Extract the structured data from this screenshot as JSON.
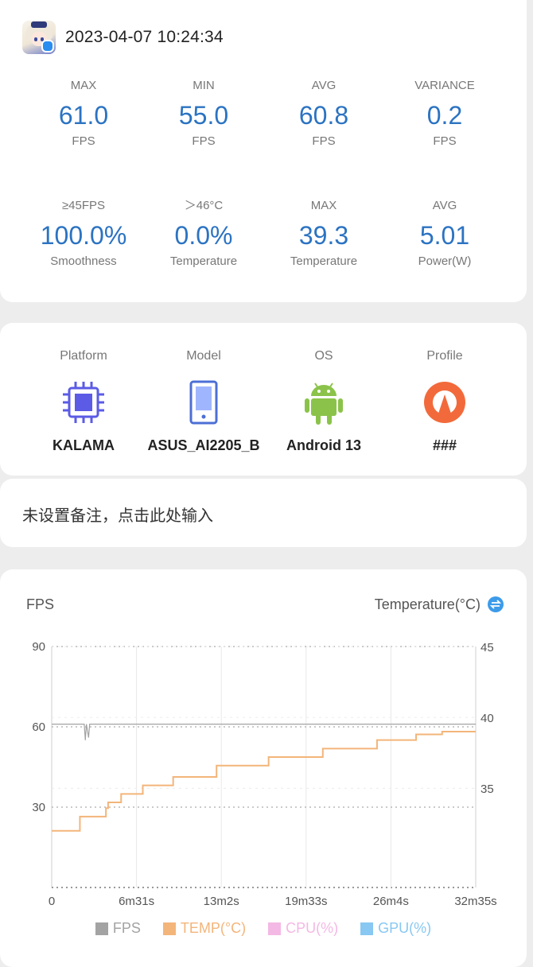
{
  "header": {
    "datetime": "2023-04-07 10:24:34"
  },
  "stats": [
    {
      "label": "MAX",
      "value": "61.0",
      "unit": "FPS"
    },
    {
      "label": "MIN",
      "value": "55.0",
      "unit": "FPS"
    },
    {
      "label": "AVG",
      "value": "60.8",
      "unit": "FPS"
    },
    {
      "label": "VARIANCE",
      "value": "0.2",
      "unit": "FPS"
    },
    {
      "label": "≥45FPS",
      "value": "100.0%",
      "unit": "Smoothness"
    },
    {
      "label": "＞46°C",
      "value": "0.0%",
      "unit": "Temperature"
    },
    {
      "label": "MAX",
      "value": "39.3",
      "unit": "Temperature"
    },
    {
      "label": "AVG",
      "value": "5.01",
      "unit": "Power(W)"
    }
  ],
  "device": {
    "platform": {
      "label": "Platform",
      "value": "KALAMA",
      "icon": "chip-icon"
    },
    "model": {
      "label": "Model",
      "value": "ASUS_AI2205_B",
      "icon": "phone-icon"
    },
    "os": {
      "label": "OS",
      "value": "Android 13",
      "icon": "android-icon"
    },
    "profile": {
      "label": "Profile",
      "value": "###",
      "icon": "profile-icon"
    }
  },
  "note": {
    "placeholder": "未设置备注，点击此处输入"
  },
  "chart": {
    "left_title": "FPS",
    "right_title": "Temperature(°C)",
    "toggle_icon": "swap-icon",
    "legend": [
      {
        "name": "FPS",
        "color": "#a3a3a3"
      },
      {
        "name": "TEMP(°C)",
        "color": "#f3b57a"
      },
      {
        "name": "CPU(%)",
        "color": "#f4b8e4"
      },
      {
        "name": "GPU(%)",
        "color": "#88c8f2"
      }
    ]
  },
  "chart_data": {
    "type": "line",
    "x_tick_labels": [
      "0",
      "6m31s",
      "13m2s",
      "19m33s",
      "26m4s",
      "32m35s"
    ],
    "x_ticks_seconds": [
      0,
      391,
      782,
      1173,
      1564,
      1955
    ],
    "xlim_seconds": [
      0,
      1955
    ],
    "y_left": {
      "label": "FPS",
      "ticks": [
        30,
        60,
        90
      ],
      "lim": [
        0,
        90
      ]
    },
    "y_right": {
      "label": "Temperature(°C)",
      "ticks": [
        35,
        40,
        45
      ],
      "lim": [
        28,
        45
      ]
    },
    "grid": true,
    "legend_position": "bottom",
    "series": [
      {
        "name": "FPS",
        "axis": "left",
        "color": "#a3a3a3",
        "x": [
          0,
          100,
          150,
          155,
          160,
          170,
          175,
          300,
          600,
          900,
          1200,
          1500,
          1800,
          1955
        ],
        "y": [
          61,
          61,
          61,
          55,
          61,
          56,
          61,
          61,
          61,
          61,
          61,
          61,
          61,
          61
        ]
      },
      {
        "name": "TEMP(°C)",
        "axis": "right",
        "color": "#f3b57a",
        "x": [
          0,
          120,
          130,
          250,
          260,
          320,
          420,
          560,
          760,
          1000,
          1250,
          1500,
          1680,
          1800,
          1955
        ],
        "y": [
          32.0,
          32.0,
          33.0,
          33.6,
          34.0,
          34.6,
          35.2,
          35.8,
          36.6,
          37.2,
          37.8,
          38.4,
          38.8,
          39.0,
          39.0
        ]
      },
      {
        "name": "CPU(%)",
        "axis": "left",
        "color": "#f4b8e4",
        "x": [],
        "y": []
      },
      {
        "name": "GPU(%)",
        "axis": "left",
        "color": "#88c8f2",
        "x": [],
        "y": []
      }
    ]
  }
}
